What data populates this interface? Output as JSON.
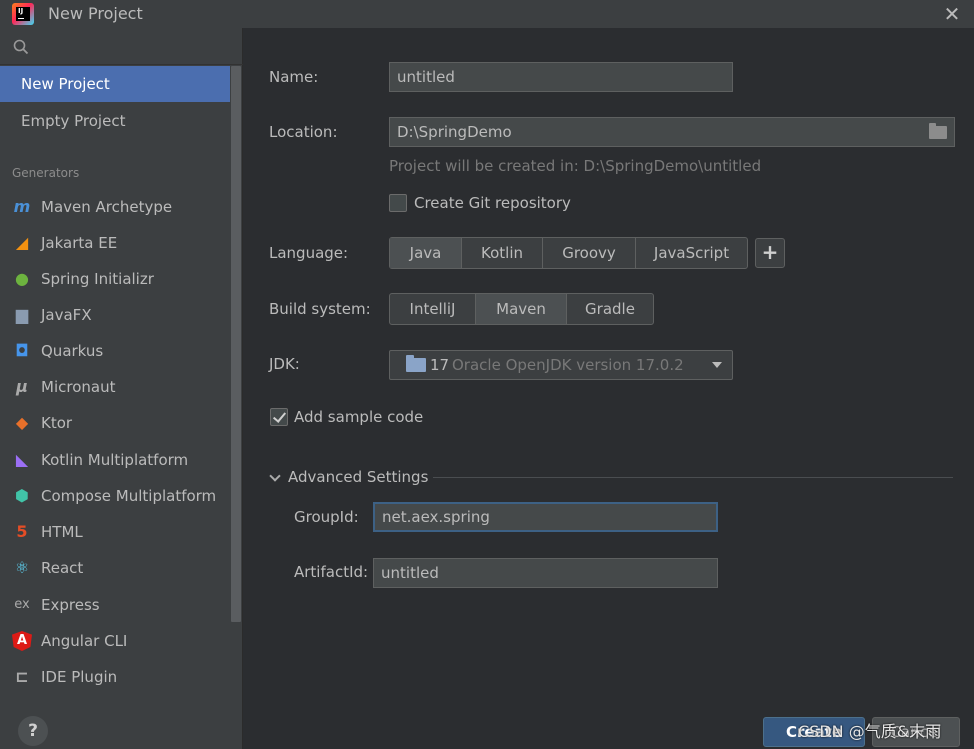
{
  "window": {
    "title": "New Project"
  },
  "sidebar": {
    "items": [
      {
        "label": "New Project",
        "selected": true
      },
      {
        "label": "Empty Project",
        "selected": false
      }
    ],
    "generators_header": "Generators",
    "generators": [
      {
        "label": "Maven Archetype",
        "icon": "maven-icon"
      },
      {
        "label": "Jakarta EE",
        "icon": "jakarta-ee-icon"
      },
      {
        "label": "Spring Initializr",
        "icon": "spring-icon"
      },
      {
        "label": "JavaFX",
        "icon": "javafx-icon"
      },
      {
        "label": "Quarkus",
        "icon": "quarkus-icon"
      },
      {
        "label": "Micronaut",
        "icon": "micronaut-icon"
      },
      {
        "label": "Ktor",
        "icon": "ktor-icon"
      },
      {
        "label": "Kotlin Multiplatform",
        "icon": "kotlin-icon"
      },
      {
        "label": "Compose Multiplatform",
        "icon": "compose-icon"
      },
      {
        "label": "HTML",
        "icon": "html5-icon"
      },
      {
        "label": "React",
        "icon": "react-icon"
      },
      {
        "label": "Express",
        "icon": "express-icon"
      },
      {
        "label": "Angular CLI",
        "icon": "angular-icon"
      },
      {
        "label": "IDE Plugin",
        "icon": "plugin-icon"
      }
    ],
    "help_label": "?"
  },
  "form": {
    "name_label": "Name:",
    "name_value": "untitled",
    "location_label": "Location:",
    "location_value": "D:\\SpringDemo",
    "location_hint": "Project will be created in: D:\\SpringDemo\\untitled",
    "git_label": "Create Git repository",
    "git_checked": false,
    "language_label": "Language:",
    "languages": [
      "Java",
      "Kotlin",
      "Groovy",
      "JavaScript"
    ],
    "language_selected": "Java",
    "add_language": "+",
    "build_label": "Build system:",
    "build_systems": [
      "IntelliJ",
      "Maven",
      "Gradle"
    ],
    "build_selected": "Maven",
    "jdk_label": "JDK:",
    "jdk_version": "17",
    "jdk_description": "Oracle OpenJDK version 17.0.2",
    "sample_label": "Add sample code",
    "sample_checked": true,
    "advanced_label": "Advanced Settings",
    "group_label": "GroupId:",
    "group_value": "net.aex.spring",
    "artifact_label": "ArtifactId:",
    "artifact_value": "untitled"
  },
  "footer": {
    "create_label": "Create",
    "cancel_label": "Cancel"
  },
  "watermark": "CSDN @气质&末雨",
  "colors": {
    "accent": "#4b6eaf",
    "background": "#2b2d30",
    "sidebar": "#3c3f41",
    "focus_border": "#3d6185"
  }
}
